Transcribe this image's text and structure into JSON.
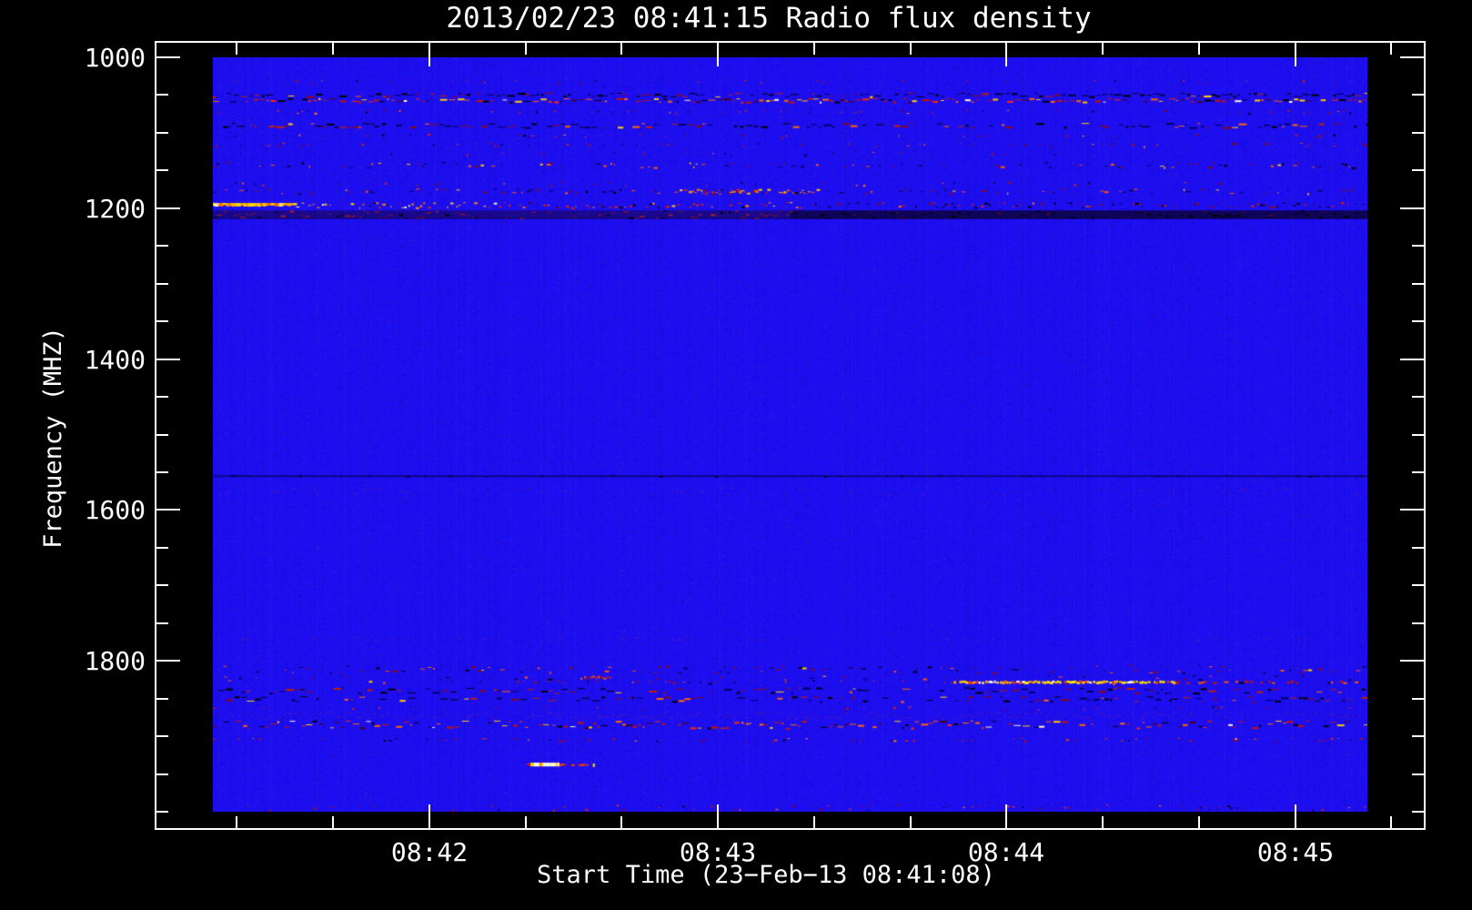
{
  "title": "2013/02/23 08:41:15 Radio flux density",
  "chart_data": {
    "type": "heatmap",
    "title": "2013/02/23 08:41:15 Radio flux density",
    "xlabel": "Start Time (23−Feb−13 08:41:08)",
    "ylabel": "Frequency (MHZ)",
    "x_axis": {
      "start_time_label": "08:41:08",
      "major_ticks": [
        {
          "label": "08:42",
          "t": 52
        },
        {
          "label": "08:43",
          "t": 112
        },
        {
          "label": "08:44",
          "t": 172
        },
        {
          "label": "08:45",
          "t": 232
        }
      ],
      "minor_ticks_t": [
        12,
        32,
        72,
        92,
        132,
        152,
        192,
        212,
        252
      ]
    },
    "y_axis": {
      "unit": "MHZ",
      "major_ticks": [
        {
          "label": "1000",
          "f": 1000
        },
        {
          "label": "1200",
          "f": 1200
        },
        {
          "label": "1400",
          "f": 1400
        },
        {
          "label": "1600",
          "f": 1600
        },
        {
          "label": "1800",
          "f": 1800
        }
      ],
      "minor_ticks_f": [
        1050,
        1100,
        1150,
        1250,
        1300,
        1350,
        1450,
        1500,
        1550,
        1650,
        1700,
        1750,
        1850,
        1900,
        1950,
        2000
      ],
      "data_range_mhz": [
        1000,
        2000
      ],
      "inverted": true
    },
    "data_time_span_s": [
      7,
      247
    ],
    "colors": {
      "page_background": "#000000",
      "quiet_background": "#1d0ef0",
      "frame": "#ffffff",
      "text": "#ffffff",
      "rfi_red": "#c81400",
      "rfi_orange": "#ff6600",
      "rfi_yellow": "#ffd000",
      "rfi_white": "#fff6c8",
      "rfi_black": "#000000",
      "rfi_maroon": "#6a1040"
    },
    "bands": [
      {
        "f0": 1030,
        "f1": 1035,
        "style": "sparse",
        "density": 0.1
      },
      {
        "f0": 1047,
        "f1": 1053,
        "style": "dense_dark",
        "density": 0.75,
        "dark_right": true
      },
      {
        "f0": 1054,
        "f1": 1060,
        "style": "dense_hot",
        "density": 0.85
      },
      {
        "f0": 1069,
        "f1": 1075,
        "style": "sparse",
        "density": 0.15
      },
      {
        "f0": 1087,
        "f1": 1094,
        "style": "dense_dark",
        "density": 0.7
      },
      {
        "f0": 1101,
        "f1": 1107,
        "style": "sparse",
        "density": 0.12
      },
      {
        "f0": 1113,
        "f1": 1119,
        "style": "sparse",
        "density": 0.18
      },
      {
        "f0": 1125,
        "f1": 1130,
        "style": "sparse",
        "density": 0.06
      },
      {
        "f0": 1139,
        "f1": 1147,
        "style": "mixed",
        "density": 0.4
      },
      {
        "f0": 1165,
        "f1": 1171,
        "style": "sparse",
        "density": 0.12
      },
      {
        "f0": 1174,
        "f1": 1182,
        "style": "mixed",
        "density": 0.5,
        "hotspot": {
          "t0": 103,
          "t1": 131
        }
      },
      {
        "f0": 1192,
        "f1": 1200,
        "style": "hot_gradient",
        "density": 0.8
      },
      {
        "f0": 1203,
        "f1": 1214,
        "style": "dark_maroon",
        "density": 0.55
      },
      {
        "f0": 1554,
        "f1": 1556,
        "style": "thin_dark",
        "density": 1.0
      },
      {
        "f0": 1570,
        "f1": 1580,
        "style": "faint_red",
        "density": 0.06
      },
      {
        "f0": 1768,
        "f1": 1773,
        "style": "faint_red",
        "density": 0.05
      },
      {
        "f0": 1806,
        "f1": 1817,
        "style": "mixed",
        "density": 0.5
      },
      {
        "f0": 1819,
        "f1": 1831,
        "style": "mixed",
        "density": 0.3
      },
      {
        "f0": 1835,
        "f1": 1844,
        "style": "dense_dark",
        "density": 0.6
      },
      {
        "f0": 1847,
        "f1": 1855,
        "style": "dense_dark",
        "density": 0.55
      },
      {
        "f0": 1860,
        "f1": 1866,
        "style": "sparse",
        "density": 0.1
      },
      {
        "f0": 1868,
        "f1": 1876,
        "style": "faint_red",
        "density": 0.2
      },
      {
        "f0": 1879,
        "f1": 1890,
        "style": "dense_hot",
        "density": 0.8
      },
      {
        "f0": 1902,
        "f1": 1907,
        "style": "sparse",
        "density": 0.25
      },
      {
        "f0": 1990,
        "f1": 1999,
        "style": "sparse",
        "density": 0.2
      }
    ],
    "features": [
      {
        "type": "red_dots",
        "f0": 1826,
        "f1": 1830,
        "t0": 60,
        "t1": 161
      },
      {
        "type": "bright_line",
        "f0": 1826,
        "f1": 1830,
        "t0": 161,
        "t1": 207
      },
      {
        "type": "red_dashes",
        "f0": 1826,
        "f1": 1830,
        "t0": 207,
        "t1": 246
      },
      {
        "type": "red_patch",
        "f0": 1819,
        "f1": 1825,
        "t0": 83,
        "t1": 90
      },
      {
        "type": "bright_streak",
        "f0": 1935,
        "f1": 1941,
        "t0": 73,
        "t1": 79
      },
      {
        "type": "red_dash_tail",
        "f0": 1936,
        "f1": 1940,
        "t0": 79,
        "t1": 85
      },
      {
        "type": "yellow_dot",
        "f0": 1936,
        "f1": 1939,
        "t0": 86,
        "t1": 87
      }
    ]
  }
}
